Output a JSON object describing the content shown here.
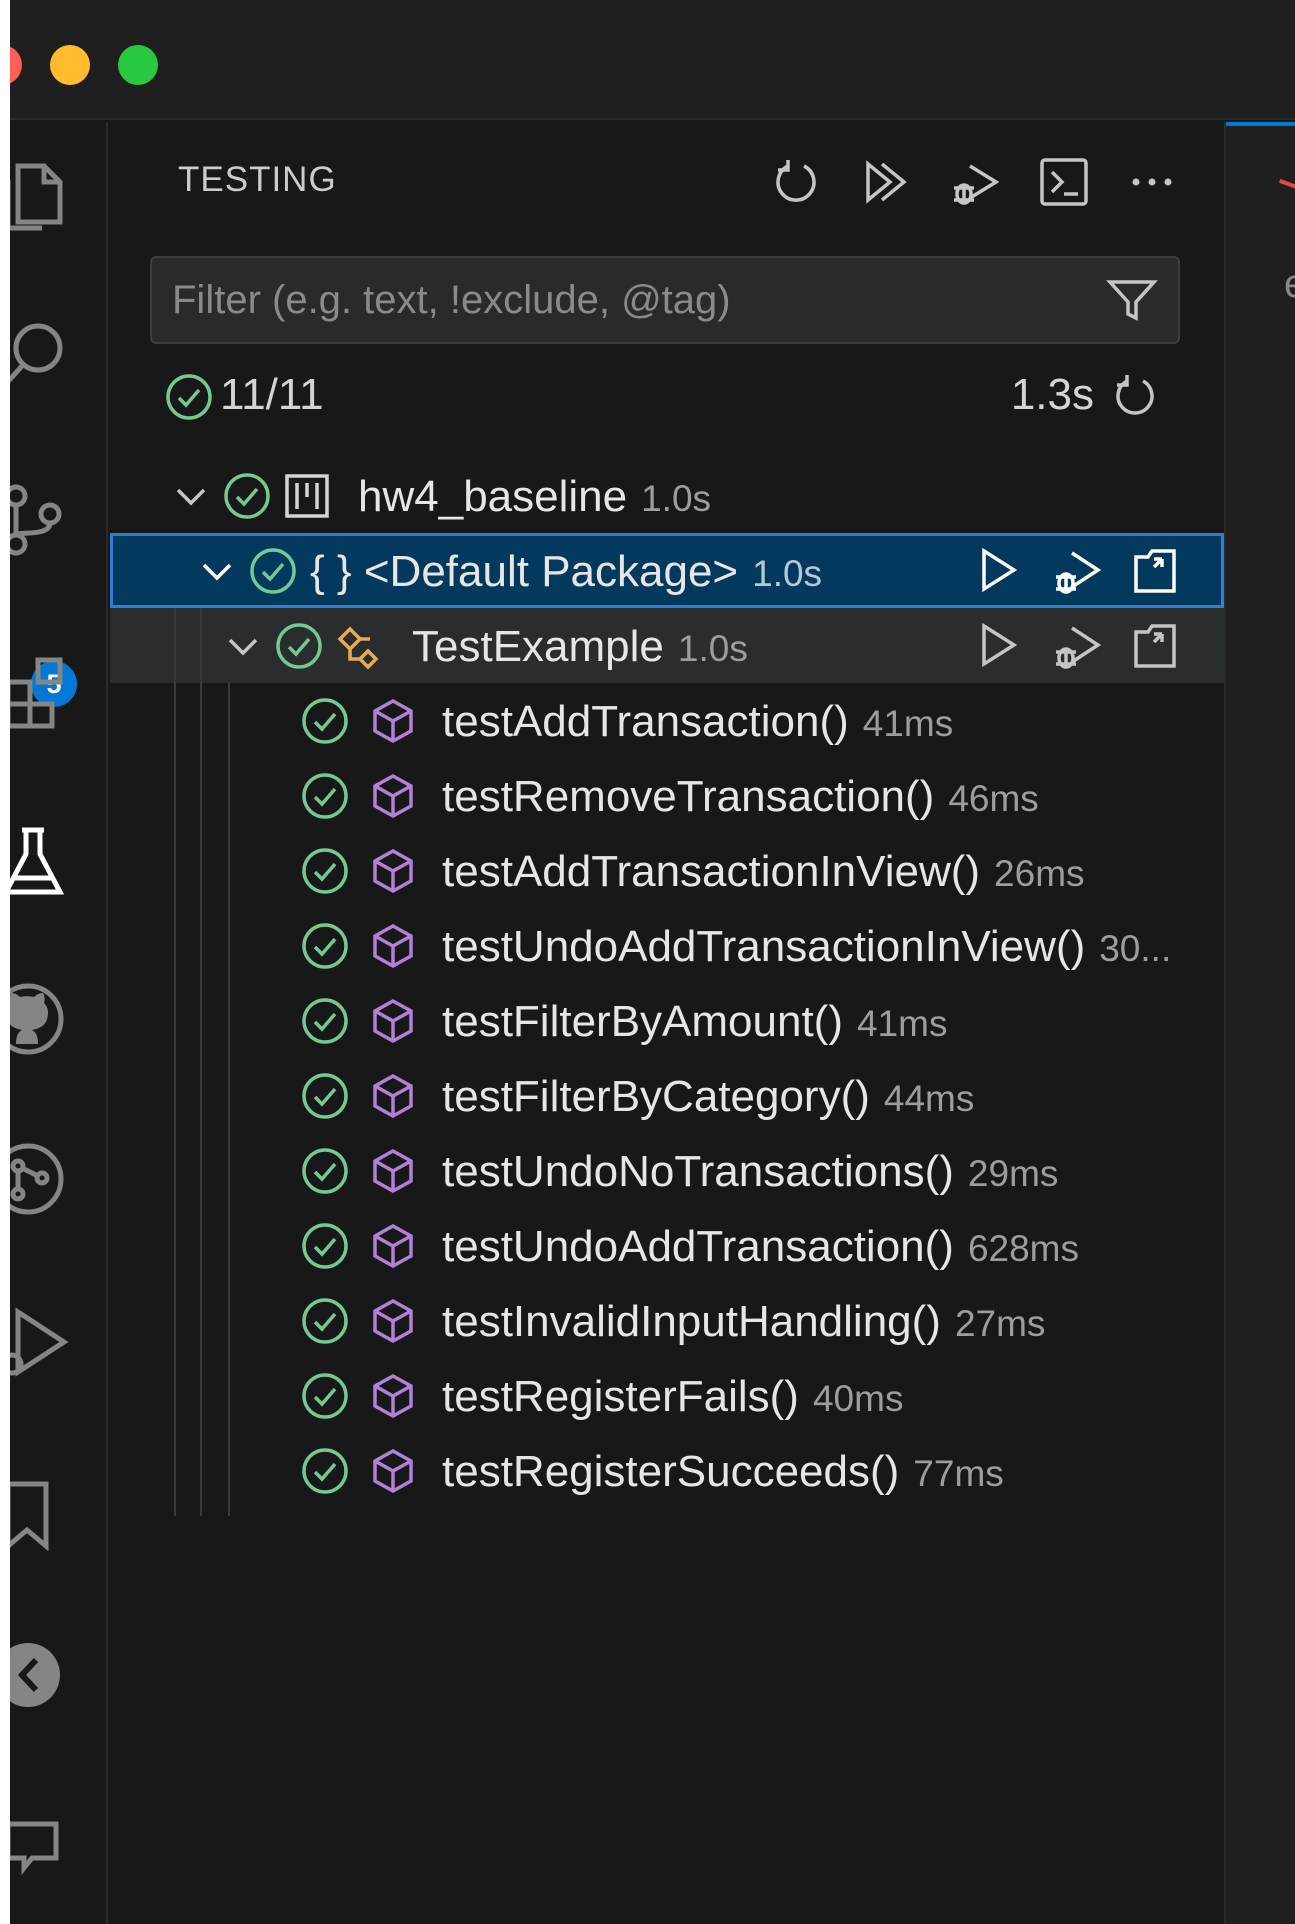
{
  "window": {
    "traffic_lights": [
      "close",
      "minimize",
      "zoom"
    ]
  },
  "activity_bar": {
    "items": [
      {
        "icon": "files-icon"
      },
      {
        "icon": "search-icon"
      },
      {
        "icon": "source-control-icon",
        "badge": "5"
      },
      {
        "icon": "extensions-icon"
      },
      {
        "icon": "testing-icon",
        "active": true
      },
      {
        "icon": "github-icon"
      },
      {
        "icon": "git-graph-icon"
      },
      {
        "icon": "run-debug-icon"
      },
      {
        "icon": "bookmark-icon"
      },
      {
        "icon": "remote-explorer-icon"
      },
      {
        "icon": "chat-icon"
      }
    ]
  },
  "panel": {
    "title": "TESTING",
    "toolbar": [
      "refresh-icon",
      "run-all-icon",
      "debug-all-icon",
      "terminal-icon",
      "more-icon"
    ]
  },
  "filter": {
    "placeholder": "Filter (e.g. text, !exclude, @tag)",
    "value": ""
  },
  "summary": {
    "count": "11/11",
    "duration": "1.3s"
  },
  "tree": {
    "project": {
      "name": "hw4_baseline",
      "duration": "1.0s"
    },
    "package": {
      "name": "<Default Package>",
      "duration": "1.0s",
      "brace": "{ }"
    },
    "class": {
      "name": "TestExample",
      "duration": "1.0s"
    },
    "tests": [
      {
        "name": "testAddTransaction()",
        "duration": "41ms"
      },
      {
        "name": "testRemoveTransaction()",
        "duration": "46ms"
      },
      {
        "name": "testAddTransactionInView()",
        "duration": "26ms"
      },
      {
        "name": "testUndoAddTransactionInView()",
        "duration": "30..."
      },
      {
        "name": "testFilterByAmount()",
        "duration": "41ms"
      },
      {
        "name": "testFilterByCategory()",
        "duration": "44ms"
      },
      {
        "name": "testUndoNoTransactions()",
        "duration": "29ms"
      },
      {
        "name": "testUndoAddTransaction()",
        "duration": "628ms"
      },
      {
        "name": "testInvalidInputHandling()",
        "duration": "27ms"
      },
      {
        "name": "testRegisterFails()",
        "duration": "40ms"
      },
      {
        "name": "testRegisterSucceeds()",
        "duration": "77ms"
      }
    ]
  },
  "editor_edge": {
    "letter": "e"
  },
  "colors": {
    "pass": "#73c991",
    "method": "#b180d7",
    "class": "#e8ab53",
    "accent": "#0078d4"
  }
}
